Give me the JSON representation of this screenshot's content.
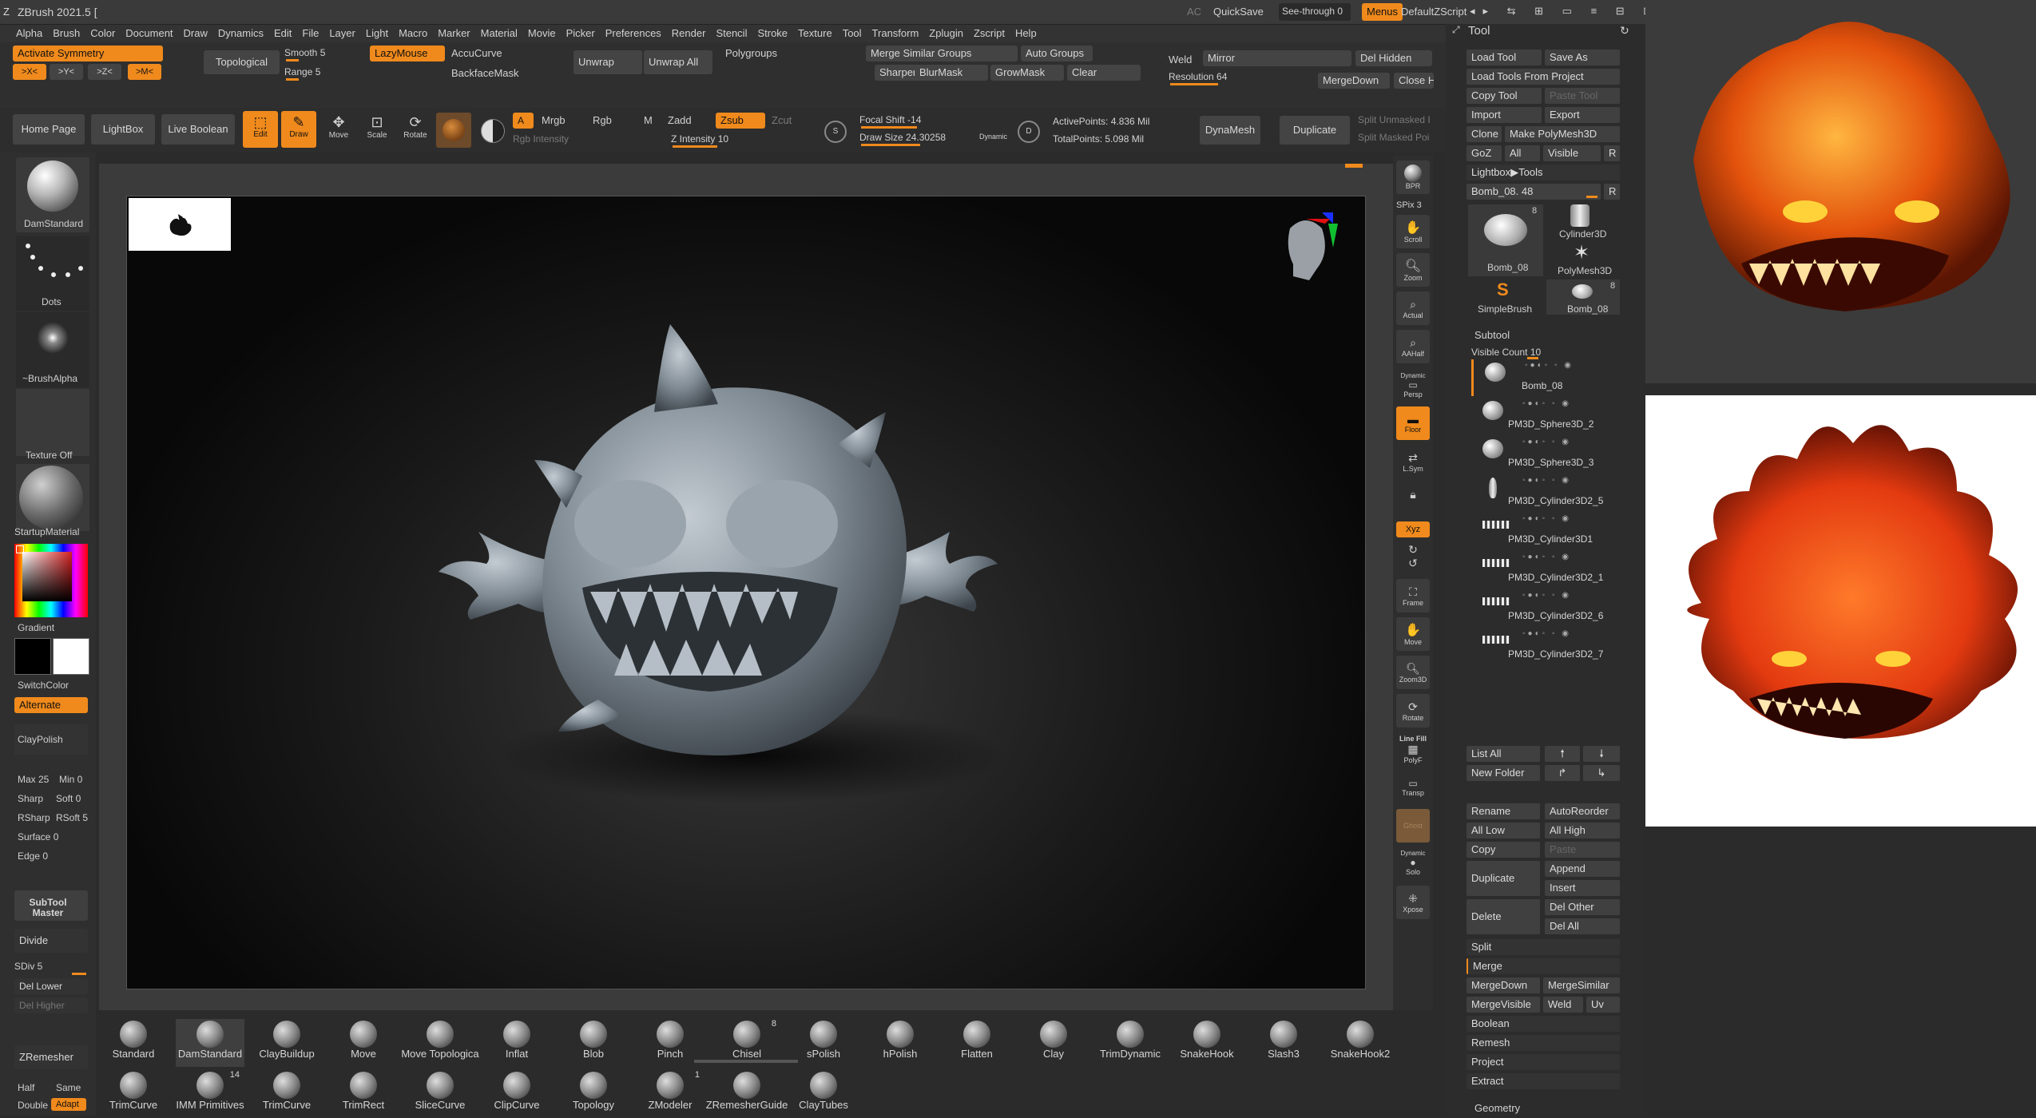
{
  "titlebar": {
    "app_title": "ZBrush 2021.5 [",
    "ac": "AC",
    "quicksave": "QuickSave",
    "see_through": "See-through  0",
    "menus": "Menus",
    "script": "DefaultZScript"
  },
  "menu": [
    "Alpha",
    "Brush",
    "Color",
    "Document",
    "Draw",
    "Dynamics",
    "Edit",
    "File",
    "Layer",
    "Light",
    "Macro",
    "Marker",
    "Material",
    "Movie",
    "Picker",
    "Preferences",
    "Render",
    "Stencil",
    "Stroke",
    "Texture",
    "Tool",
    "Transform",
    "Zplugin",
    "Zscript",
    "Help"
  ],
  "top": {
    "activate_symmetry": "Activate Symmetry",
    "sym_x": ">X<",
    "sym_y": ">Y<",
    "sym_z": ">Z<",
    "sym_m": ">M<",
    "topological": "Topological",
    "smooth": "Smooth 5",
    "range": "Range 5",
    "lazymouse": "LazyMouse",
    "accucurve": "AccuCurve",
    "backfacemask": "BackfaceMask",
    "unwrap": "Unwrap",
    "unwrap_all": "Unwrap All",
    "polygroups": "Polygroups",
    "merge_similar_groups": "Merge Similar Groups",
    "auto_groups": "Auto Groups",
    "sharpen_mask": "SharpenMask",
    "blur_mask": "BlurMask",
    "grow_mask": "GrowMask",
    "clear": "Clear",
    "weld": "Weld",
    "mirror": "Mirror",
    "del_hidden": "Del Hidden",
    "resolution": "Resolution 64",
    "merge_down": "MergeDown",
    "close_h": "Close H"
  },
  "shelf": {
    "home_page": "Home Page",
    "lightbox": "LightBox",
    "live_boolean": "Live Boolean",
    "edit": "Edit",
    "draw": "Draw",
    "move": "Move",
    "scale": "Scale",
    "rotate": "Rotate",
    "a": "A",
    "mrgb": "Mrgb",
    "rgb": "Rgb",
    "m": "M",
    "zadd": "Zadd",
    "zsub": "Zsub",
    "zcut": "Zcut",
    "rgb_intensity": "Rgb Intensity",
    "z_intensity": "Z Intensity 10",
    "focal_shift": "Focal Shift -14",
    "draw_size": "Draw Size 24.30258",
    "dynamic": "Dynamic",
    "active_points": "ActivePoints: 4.836 Mil",
    "total_points": "TotalPoints: 5.098 Mil",
    "dynamesh": "DynaMesh",
    "duplicate": "Duplicate",
    "split_unmasked": "Split Unmasked I",
    "split_masked": "Split Masked Poi"
  },
  "left": {
    "brush": "DamStandard",
    "stroke": "Dots",
    "alpha": "~BrushAlpha",
    "texture": "Texture Off",
    "material": "StartupMaterial",
    "gradient": "Gradient",
    "switch_color": "SwitchColor",
    "alternate": "Alternate",
    "claypolish": "ClayPolish",
    "max": "Max 25",
    "min": "Min 0",
    "sharp": "Sharp",
    "soft": "Soft 0",
    "rsharp": "RSharp",
    "rsoft": "RSoft 5",
    "surface": "Surface 0",
    "edge": "Edge 0",
    "subtool_master": "SubTool Master",
    "divide": "Divide",
    "sdiv": "SDiv 5",
    "del_lower": "Del Lower",
    "del_higher": "Del Higher",
    "zremesher": "ZRemesher",
    "half": "Half",
    "same": "Same",
    "double": "Double",
    "adapt": "Adapt"
  },
  "right_strip": {
    "bpr": "BPR",
    "spix": "SPix 3",
    "scroll": "Scroll",
    "zoom": "Zoom",
    "actual": "Actual",
    "aahalf": "AAHalf",
    "persp": "Persp",
    "floor": "Floor",
    "lsym": "L.Sym",
    "xyz": "Xyz",
    "frame": "Frame",
    "move": "Move",
    "zoom3d": "Zoom3D",
    "rotate": "Rotate",
    "line_fill": "Line Fill",
    "polyf": "PolyF",
    "transp": "Transp",
    "ghost": "Ghost",
    "solo": "Solo",
    "dynamic": "Dynamic",
    "xpose": "Xpose"
  },
  "tool_panel": {
    "title": "Tool",
    "load_tool": "Load Tool",
    "save_as": "Save As",
    "load_from_project": "Load Tools From Project",
    "copy_tool": "Copy Tool",
    "paste_tool": "Paste Tool",
    "import": "Import",
    "export": "Export",
    "clone": "Clone",
    "make_polymesh": "Make PolyMesh3D",
    "goz": "GoZ",
    "all": "All",
    "visible": "Visible",
    "r": "R",
    "lightbox_tools": "Lightbox▶Tools",
    "current_tool": "Bomb_08. 48",
    "thumbs": [
      {
        "label": "Bomb_08",
        "count": "8"
      },
      {
        "label": "Cylinder3D",
        "count": ""
      },
      {
        "label": "PolyMesh3D",
        "count": ""
      },
      {
        "label": "SimpleBrush",
        "count": ""
      },
      {
        "label": "Bomb_08",
        "count": "8"
      }
    ],
    "subtool": "Subtool",
    "visible_count": "Visible Count 10",
    "subtools": [
      "Bomb_08",
      "PM3D_Sphere3D_2",
      "PM3D_Sphere3D_3",
      "PM3D_Cylinder3D2_5",
      "PM3D_Cylinder3D1",
      "PM3D_Cylinder3D2_1",
      "PM3D_Cylinder3D2_6",
      "PM3D_Cylinder3D2_7"
    ],
    "list_all": "List All",
    "new_folder": "New Folder",
    "rename": "Rename",
    "auto_reorder": "AutoReorder",
    "all_low": "All Low",
    "all_high": "All High",
    "copy": "Copy",
    "paste": "Paste",
    "duplicate": "Duplicate",
    "append": "Append",
    "insert": "Insert",
    "delete": "Delete",
    "del_other": "Del Other",
    "del_all": "Del All",
    "split": "Split",
    "merge": "Merge",
    "merge_down": "MergeDown",
    "merge_similar": "MergeSimilar",
    "merge_visible": "MergeVisible",
    "weld": "Weld",
    "uv": "Uv",
    "boolean": "Boolean",
    "remesh": "Remesh",
    "project": "Project",
    "extract": "Extract",
    "geometry": "Geometry"
  },
  "brushes_row1": [
    {
      "label": "Standard",
      "n": ""
    },
    {
      "label": "DamStandard",
      "n": ""
    },
    {
      "label": "ClayBuildup",
      "n": ""
    },
    {
      "label": "Move",
      "n": ""
    },
    {
      "label": "Move Topologica",
      "n": ""
    },
    {
      "label": "Inflat",
      "n": ""
    },
    {
      "label": "Blob",
      "n": ""
    },
    {
      "label": "Pinch",
      "n": ""
    },
    {
      "label": "Chisel",
      "n": "8"
    },
    {
      "label": "sPolish",
      "n": ""
    },
    {
      "label": "hPolish",
      "n": ""
    },
    {
      "label": "Flatten",
      "n": ""
    },
    {
      "label": "Clay",
      "n": ""
    },
    {
      "label": "TrimDynamic",
      "n": ""
    },
    {
      "label": "SnakeHook",
      "n": ""
    },
    {
      "label": "Slash3",
      "n": ""
    },
    {
      "label": "SnakeHook2",
      "n": ""
    }
  ],
  "brushes_row2": [
    {
      "label": "TrimCurve",
      "n": ""
    },
    {
      "label": "IMM Primitives",
      "n": "14"
    },
    {
      "label": "TrimCurve",
      "n": ""
    },
    {
      "label": "TrimRect",
      "n": ""
    },
    {
      "label": "SliceCurve",
      "n": ""
    },
    {
      "label": "ClipCurve",
      "n": ""
    },
    {
      "label": "Topology",
      "n": ""
    },
    {
      "label": "ZModeler",
      "n": "1"
    },
    {
      "label": "ZRemesherGuide",
      "n": ""
    },
    {
      "label": "ClayTubes",
      "n": ""
    }
  ],
  "colors": {
    "accent": "#f08a1c",
    "bg": "#2b2b2b",
    "panel": "#333333"
  }
}
